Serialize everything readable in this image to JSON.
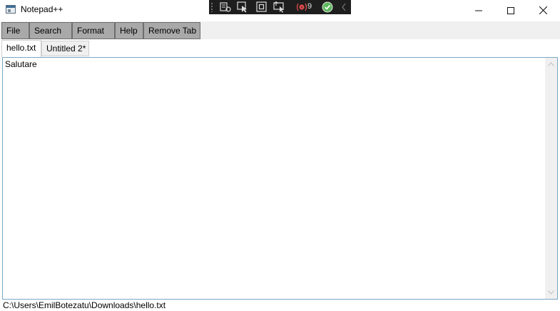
{
  "window": {
    "title": "Notepad++",
    "minimize_glyph": "—",
    "maximize_glyph": "☐",
    "close_glyph": "✕"
  },
  "debug_toolbar": {
    "icons": [
      "visual-tree-icon",
      "select-element-icon",
      "display-layout-adorners-icon",
      "track-focus-icon",
      "binding-failures-icon",
      "hot-reload-status-icon",
      "collapse-chevron-icon"
    ],
    "failure_count": "9"
  },
  "menu": {
    "items": [
      {
        "label": "File"
      },
      {
        "label": "Search"
      },
      {
        "label": "Format"
      },
      {
        "label": "Help"
      },
      {
        "label": "Remove Tab"
      }
    ]
  },
  "tabs": [
    {
      "label": "hello.txt",
      "active": true
    },
    {
      "label": "Untitled 2*",
      "active": false
    }
  ],
  "editor": {
    "content": "Salutare"
  },
  "status": {
    "path": "C:\\Users\\EmilBotezatu\\Downloads\\hello.txt"
  },
  "colors": {
    "menu_bg": "#a9a9a9",
    "editor_border": "#7aa7c7",
    "debug_bg": "#1e1e1e",
    "debug_accent_red": "#e04b4b",
    "debug_accent_green": "#5cb85c"
  }
}
